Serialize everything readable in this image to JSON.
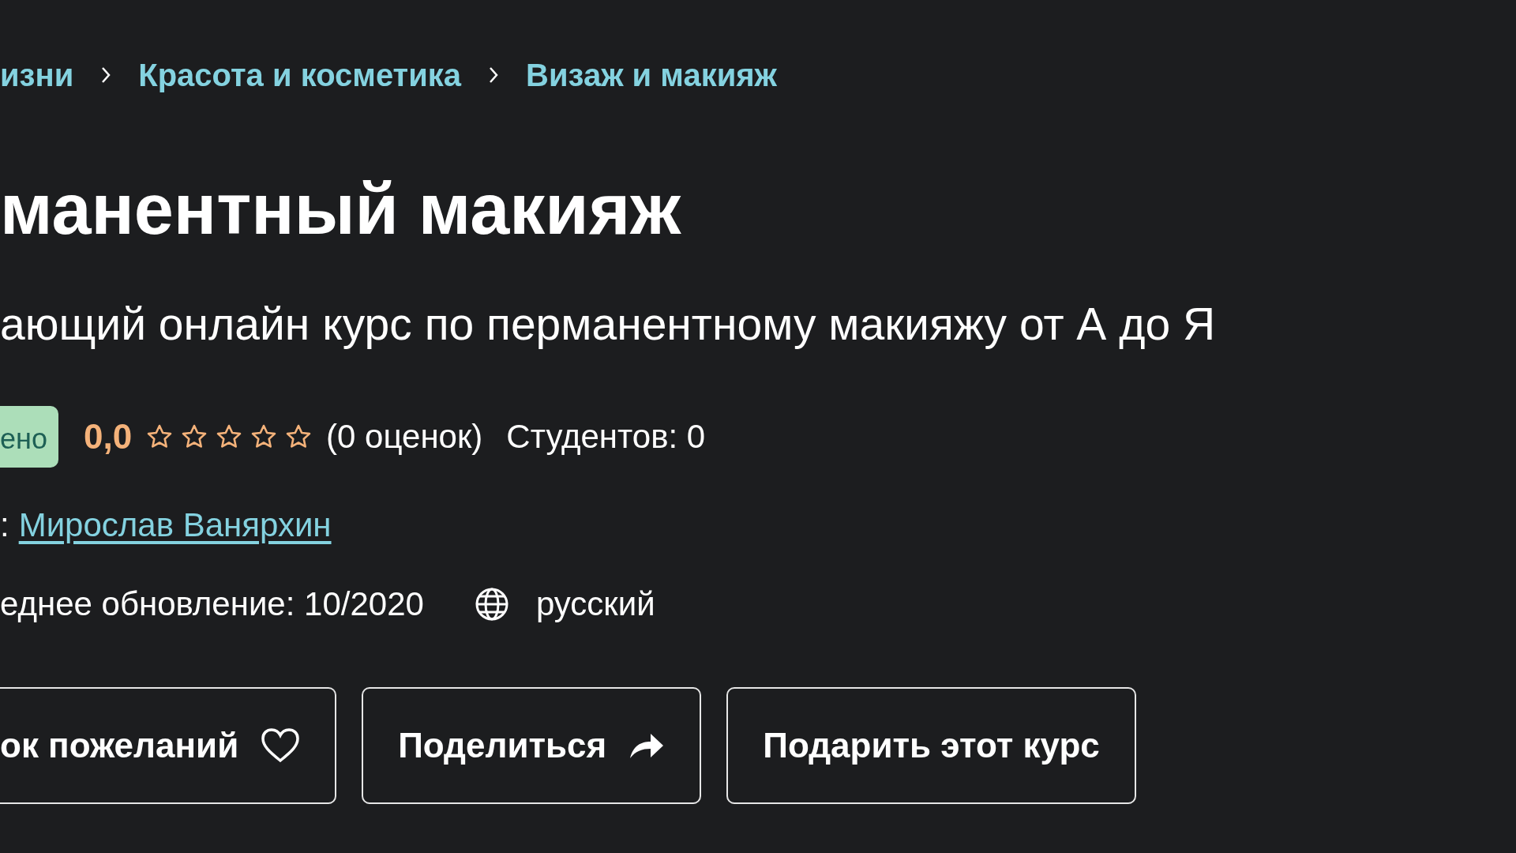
{
  "breadcrumb": [
    {
      "label": "изни"
    },
    {
      "label": "Красота и косметика"
    },
    {
      "label": "Визаж и макияж"
    }
  ],
  "title": "манентный макияж",
  "subtitle": "ающий онлайн курс по перманентному макияжу от А до Я",
  "badge": "ено",
  "rating": {
    "score": "0,0",
    "stars": 0,
    "count": "(0 оценок)"
  },
  "students": "Студентов: 0",
  "author": {
    "prefix": ":",
    "name": "Мирослав Ванярхин"
  },
  "meta": {
    "updated": "еднее обновление: 10/2020",
    "language": "русский"
  },
  "buttons": [
    {
      "label": "ок пожеланий",
      "kind": "wishlist"
    },
    {
      "label": "Поделиться",
      "kind": "share"
    },
    {
      "label": "Подарить этот курс",
      "kind": "plain"
    }
  ]
}
